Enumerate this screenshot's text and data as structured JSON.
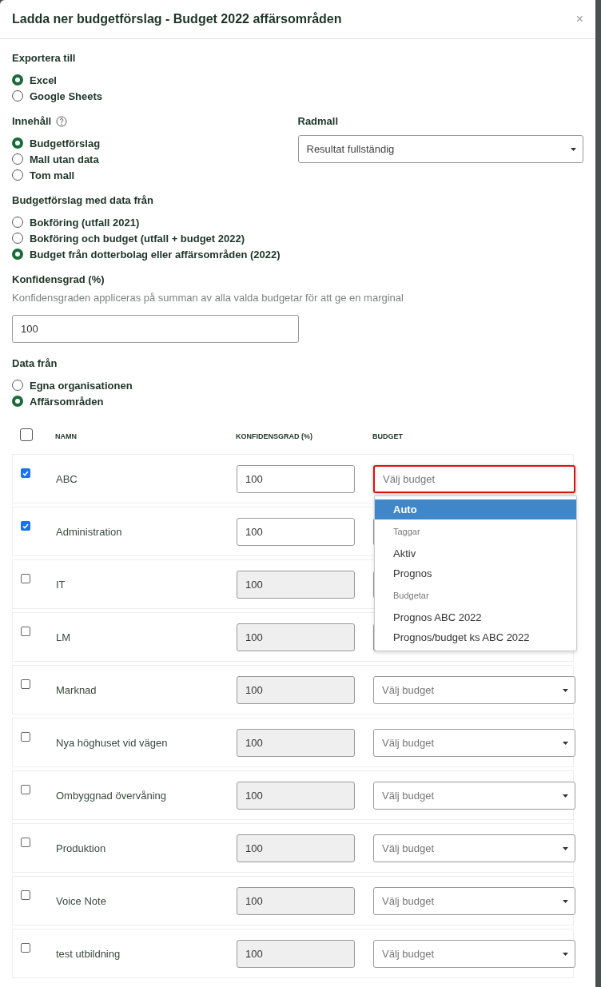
{
  "dialog": {
    "title": "Ladda ner budgetförslag - Budget 2022 affärsområden",
    "close": "×"
  },
  "export": {
    "label": "Exportera till",
    "options": [
      {
        "label": "Excel",
        "selected": true
      },
      {
        "label": "Google Sheets",
        "selected": false
      }
    ]
  },
  "content": {
    "label": "Innehåll",
    "options": [
      {
        "label": "Budgetförslag",
        "selected": true
      },
      {
        "label": "Mall utan data",
        "selected": false
      },
      {
        "label": "Tom mall",
        "selected": false
      }
    ]
  },
  "row_template": {
    "label": "Radmall",
    "value": "Resultat fullständig"
  },
  "source": {
    "label": "Budgetförslag med data från",
    "options": [
      {
        "label": "Bokföring (utfall 2021)",
        "selected": false
      },
      {
        "label": "Bokföring och budget (utfall + budget 2022)",
        "selected": false
      },
      {
        "label": "Budget från dotterbolag eller affärsområden (2022)",
        "selected": true
      }
    ]
  },
  "confidence": {
    "label": "Konfidensgrad (%)",
    "help": "Konfidensgraden appliceras på summan av alla valda budgetar för att ge en marginal",
    "value": "100"
  },
  "data_from": {
    "label": "Data från",
    "options": [
      {
        "label": "Egna organisationen",
        "selected": false
      },
      {
        "label": "Affärsområden",
        "selected": true
      }
    ]
  },
  "table": {
    "select_all_checked": false,
    "columns": [
      "NAMN",
      "KONFIDENSGRAD (%)",
      "BUDGET"
    ],
    "rows": [
      {
        "name": "ABC",
        "checked": true,
        "confidence": "100",
        "budget": {
          "placeholder": "Välj budget",
          "focused": true,
          "menu": [
            {
              "kind": "option",
              "label": "Auto",
              "selected": true
            },
            {
              "kind": "group",
              "label": "Taggar"
            },
            {
              "kind": "option",
              "label": "Aktiv",
              "selected": false
            },
            {
              "kind": "option",
              "label": "Prognos",
              "selected": false
            },
            {
              "kind": "group",
              "label": "Budgetar"
            },
            {
              "kind": "option",
              "label": "Prognos ABC 2022",
              "selected": false
            },
            {
              "kind": "option",
              "label": "Prognos/budget ks ABC 2022",
              "selected": false
            }
          ]
        }
      },
      {
        "name": "Administration",
        "checked": true,
        "confidence": "100",
        "budget": {
          "focused": false
        }
      },
      {
        "name": "IT",
        "checked": false,
        "confidence": "100",
        "budget": {
          "focused": false
        }
      },
      {
        "name": "LM",
        "checked": false,
        "confidence": "100",
        "budget": {
          "focused": false
        }
      },
      {
        "name": "Marknad",
        "checked": false,
        "confidence": "100",
        "budget": {
          "placeholder": "Välj budget",
          "focused": false
        }
      },
      {
        "name": "Nya höghuset vid vägen",
        "checked": false,
        "confidence": "100",
        "budget": {
          "placeholder": "Välj budget",
          "focused": false
        }
      },
      {
        "name": "Ombyggnad övervåning",
        "checked": false,
        "confidence": "100",
        "budget": {
          "placeholder": "Välj budget",
          "focused": false
        }
      },
      {
        "name": "Produktion",
        "checked": false,
        "confidence": "100",
        "budget": {
          "placeholder": "Välj budget",
          "focused": false
        }
      },
      {
        "name": "Voice Note",
        "checked": false,
        "confidence": "100",
        "budget": {
          "placeholder": "Välj budget",
          "focused": false
        }
      },
      {
        "name": "test utbildning",
        "checked": false,
        "confidence": "100",
        "budget": {
          "placeholder": "Välj budget",
          "focused": false
        }
      }
    ]
  }
}
